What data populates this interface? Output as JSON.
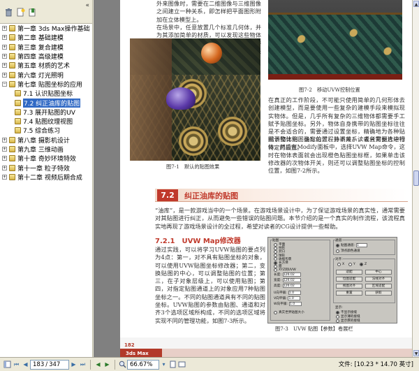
{
  "nav": {
    "collapse_label": "«",
    "bookmarks": [
      {
        "label": "第一章 3ds Max操作基础",
        "level": 0,
        "expander": "+"
      },
      {
        "label": "第二章 基础建模",
        "level": 0,
        "expander": "+"
      },
      {
        "label": "第三章 复合建模",
        "level": 0,
        "expander": "+"
      },
      {
        "label": "第四章 高级建模",
        "level": 0,
        "expander": "+"
      },
      {
        "label": "第五章 材质的艺术",
        "level": 0,
        "expander": "+"
      },
      {
        "label": "第六章 灯光照明",
        "level": 0,
        "expander": "+"
      },
      {
        "label": "第七章 贴图坐标的应用",
        "level": 0,
        "expander": "−"
      },
      {
        "label": "7.1 认识贴图坐标",
        "level": 1,
        "expander": ""
      },
      {
        "label": "7.2 纠正油库的贴图",
        "level": 1,
        "expander": "",
        "selected": true
      },
      {
        "label": "7.3 展开贴图的UV",
        "level": 1,
        "expander": ""
      },
      {
        "label": "7.4 贴图纹理视图",
        "level": 1,
        "expander": ""
      },
      {
        "label": "7.5 综合练习",
        "level": 1,
        "expander": ""
      },
      {
        "label": "第八章 摄影机设计",
        "level": 0,
        "expander": "+"
      },
      {
        "label": "第九章 三维动画",
        "level": 0,
        "expander": "+"
      },
      {
        "label": "第十章 奇妙环境特效",
        "level": 0,
        "expander": "+"
      },
      {
        "label": "第十一章 粒子特效",
        "level": 0,
        "expander": "+"
      },
      {
        "label": "第十二章 视频后期合成",
        "level": 0,
        "expander": "+"
      }
    ]
  },
  "page": {
    "top_left_text": "外来图像时，需要在二维图像与三维图像之间建立一种关系，即怎样把平面图形附加在立体模型上。",
    "para_left": "在场景中，任意放置几个标准几何体，并为其添加简单的材质，可以发现这些物体并没有使用贴图坐标也可以将材质中附带的图像协调好，如图7-1所示，所不同的是效果看起来有点失真。",
    "fig1_caption": "图7-1　默认的贴图效果",
    "fig2_caption": "图7-2　移动UVW控制位置",
    "para_right_1": "在真正的工作阶段，不可能只使用简单的几何形体去创建模型，而是要使用一些复杂的建模手段来模拟现实物体。但是，几乎所有复杂的三维物体都需要手工赋予贴图坐标。另外，物体自身携带的贴图坐标往往是不会适合的，需要通过设置坐标，精确地为各种贴图调整比例、确定位置、协调关系，或者对图片进行特定的设置。",
    "para_right_2": "赋予物体贴图坐标的过程并不难，读者只需要选中物体，然后在Modify面板中，选择UVW Map命令，这时在物体表面就会出现橙色贴图坐标框，如果单击该修改器的次物体开关，则还可以调整贴图坐标的控制位置，如图7-2所示。",
    "section_num": "7.2",
    "section_title": "纠正油库的贴图",
    "section_intro": "“油库”，是一款游戏当中的一个场景。在游戏场景设计中，为了保证游戏场景的真实性，通常需要对其贴图进行纠正，从而避免一些错误的贴图问题。本节介绍的是一个真实的制作流程，该流程真实地再现了游戏场景设计的全过程，希望对读者的CG设计提供一些帮助。",
    "sub_num": "7.2.1",
    "sub_title": "UVW Map修改器",
    "sub_body": "通过实践，可以将学习UVW贴图的要点列为4点：第一，对不具有贴图坐标的对象，可以使用UVW贴图坐标修改器；第二，变换贴图的中心，可以调整贴图的位置；第三，在子对象层级上，可以使用贴图；第四，对指定贴图通道上的对象应用7种贴图坐标之一。不同的贴图通道具有不同的贴图坐标。UVW贴图的参数由贴图、通道和对齐3个选项区域所构成，不同的选项区域将实现不同的管理功能，如图7-3所示。",
    "fig3_caption": "图7-3　UVW 贴图【参数】卷展栏",
    "page_number": "182",
    "footer_brand": "3ds Max"
  },
  "uvw": {
    "group_mapping": "贴图:",
    "options": [
      "平面",
      "柱形",
      "封口",
      "球形",
      "收缩包裹",
      "长方体",
      "面",
      "XYZ到UVW"
    ],
    "selected_option": "长方体",
    "length_label": "长度:",
    "length_value": "126.02",
    "width_label": "宽度:",
    "width_value": "126.02",
    "height_label": "高度:",
    "height_value": "126.02",
    "u_tile_label": "U向平铺:",
    "u_tile_value": "1.0",
    "v_tile_label": "V向平铺:",
    "v_tile_value": "1.0",
    "w_tile_label": "W向平铺:",
    "w_tile_value": "1.0",
    "flip_label": "翻转",
    "real_world_label": "真实世界贴图大小",
    "group_channel": "通道:",
    "channel_map_label": "贴图通道:",
    "channel_value": "1",
    "vertex_color_label": "顶点颜色通道",
    "group_alignment": "对齐:",
    "axes": [
      "X",
      "Y",
      "Z"
    ],
    "buttons": [
      "适配",
      "中心",
      "位图适配",
      "法线对齐",
      "视图对齐",
      "区域适配",
      "重置",
      "获取"
    ],
    "display_label": "显示:",
    "display_options": [
      "不显示接缝",
      "显示薄的接缝",
      "显示厚的接缝"
    ]
  },
  "status": {
    "page_current": "183",
    "page_total": "347",
    "zoom": "66.67%",
    "doc_size": "文件: [10.23 * 14.70 英寸]"
  },
  "colors": {
    "selection": "#316ac5",
    "section_accent": "#c0392b",
    "pane_bg": "#ece9d8"
  }
}
